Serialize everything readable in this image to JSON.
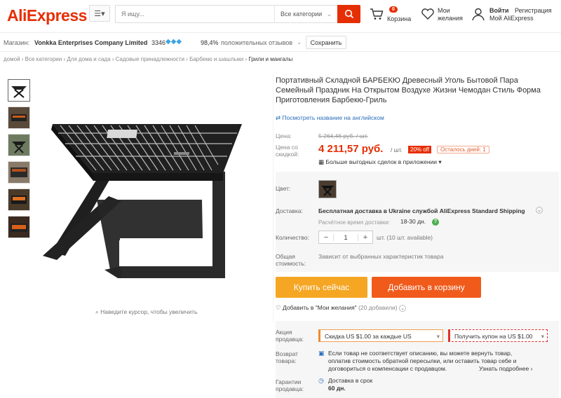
{
  "header": {
    "logo": "AliExpress",
    "menu_icon": "menu-icon",
    "search_placeholder": "Я ищу...",
    "search_category": "Все категории",
    "cart_label": "Корзина",
    "cart_count": "0",
    "wish_line1": "Мои",
    "wish_line2": "желания",
    "login": "Войти",
    "register": "Регистрация",
    "my_ali": "Мой AliExpress"
  },
  "store": {
    "label": "Магазин:",
    "name": "Vonkka Enterprises Company Limited",
    "score": "3346",
    "feedback_pct": "98,4%",
    "feedback_label": "положительных отзывов",
    "save_button": "Сохранить"
  },
  "breadcrumb": [
    "домой",
    "Все категории",
    "Для дома и сада",
    "Садовые принадлежности",
    "Барбекю и шашлыки",
    "Грили и мангалы"
  ],
  "gallery": {
    "zoom_hint": "Наведите курсор, чтобы увеличить"
  },
  "product": {
    "title": "Портативный Складной БАРБЕКЮ Древесный Уголь Бытовой Пара Семейный Праздник На Открытом Воздухе Жизни Чемодан Стиль Форма Приготовления Барбекю-Гриль",
    "translate_link": "Посмотреть название на английском",
    "price_label": "Цена:",
    "old_price": "5 264,46 руб. / шт.",
    "discount_label_1": "Цена со",
    "discount_label_2": "скидкой:",
    "price": "4 211,57 руб.",
    "unit": "/ шт.",
    "discount_badge": "20% off",
    "days_left": "Осталось дней: 1",
    "app_deals": "Больше выгодных сделок в приложении",
    "color_label": "Цвет:",
    "shipping_label": "Доставка:",
    "shipping_text": "Бесплатная доставка в Ukraine службой AliExpress Standard Shipping",
    "delivery_time_label": "Расчётное время доставки:",
    "delivery_time": "18-30 дн.",
    "qty_label": "Количество:",
    "qty_minus": "−",
    "qty_value": "1",
    "qty_plus": "+",
    "qty_available": "шт. (10 шт. available)",
    "total_label_1": "Общая",
    "total_label_2": "стоимость:",
    "total_text": "Зависит от выбранных характеристик товара",
    "buy_now": "Купить сейчас",
    "add_cart": "Добавить в корзину",
    "wishlist_text": "Добавить в \"Мои желания\"",
    "wishlist_count": "(20 добавили)",
    "promo_label_1": "Акция",
    "promo_label_2": "продавца:",
    "coupon1": "Скидка US $1.00 за каждые US",
    "coupon2": "Получить купон на US $1.00",
    "return_label_1": "Возврат",
    "return_label_2": "товара:",
    "return_text_1": "Если товар не соответствует описанию, вы можете вернуть товар,",
    "return_text_2": "оплатив стоимость обратной пересылки, или оставить товар себе и",
    "return_text_3": "договориться о компенсации с продавцом.",
    "return_more": "Узнать подробнее",
    "guarantee_label_1": "Гарантии",
    "guarantee_label_2": "продавца:",
    "guarantee_text": "Доставка в срок",
    "guarantee_days": "60 дн."
  },
  "colors": {
    "brand": "#e62e04",
    "price": "#e62e04",
    "buy": "#f5a623",
    "cart": "#f05a1a",
    "link": "#2a6ebb"
  }
}
